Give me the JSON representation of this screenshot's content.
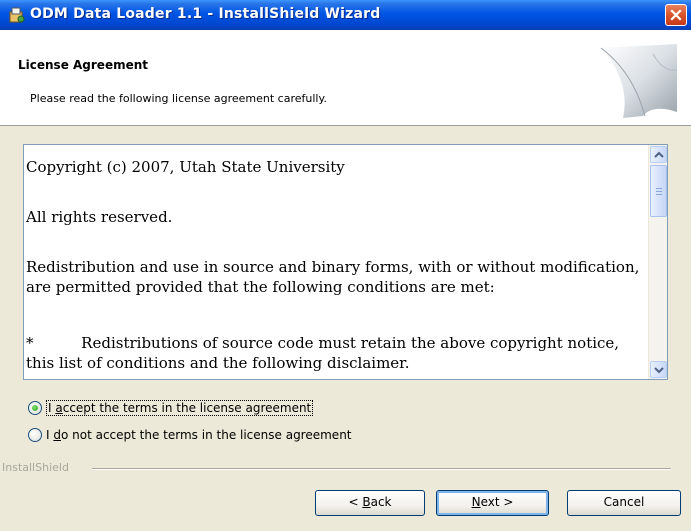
{
  "window": {
    "title": "ODM Data Loader 1.1 - InstallShield Wizard"
  },
  "banner": {
    "heading": "License Agreement",
    "subheading": "Please read the following license agreement carefully."
  },
  "license": {
    "lines": [
      "Copyright (c) 2007, Utah State University",
      "All rights reserved.",
      "Redistribution and use in source and binary forms, with or without modification, are permitted provided that the following conditions are met:",
      "*          Redistributions of source code must retain the above copyright notice, this list of conditions and the following disclaimer."
    ]
  },
  "options": {
    "accept": {
      "pre": "I ",
      "accel": "a",
      "post": "ccept the terms in the license agreement",
      "selected": true
    },
    "decline": {
      "pre": "I ",
      "accel": "d",
      "post": "o not accept the terms in the license agreement",
      "selected": false
    }
  },
  "footer": {
    "brand": "InstallShield"
  },
  "buttons": {
    "back": {
      "pre": "< ",
      "accel": "B",
      "post": "ack"
    },
    "next": {
      "pre": "",
      "accel": "N",
      "post": "ext >"
    },
    "cancel": "Cancel"
  },
  "colors": {
    "titlebar": "#0055e5",
    "window_bg": "#ece9d8",
    "close_button": "#d9532c",
    "radio_selected": "#21a121"
  },
  "icons": {
    "app": "installer-icon",
    "close": "close-icon",
    "banner": "page-curl-graphic",
    "scroll_up": "chevron-up-icon",
    "scroll_down": "chevron-down-icon"
  }
}
